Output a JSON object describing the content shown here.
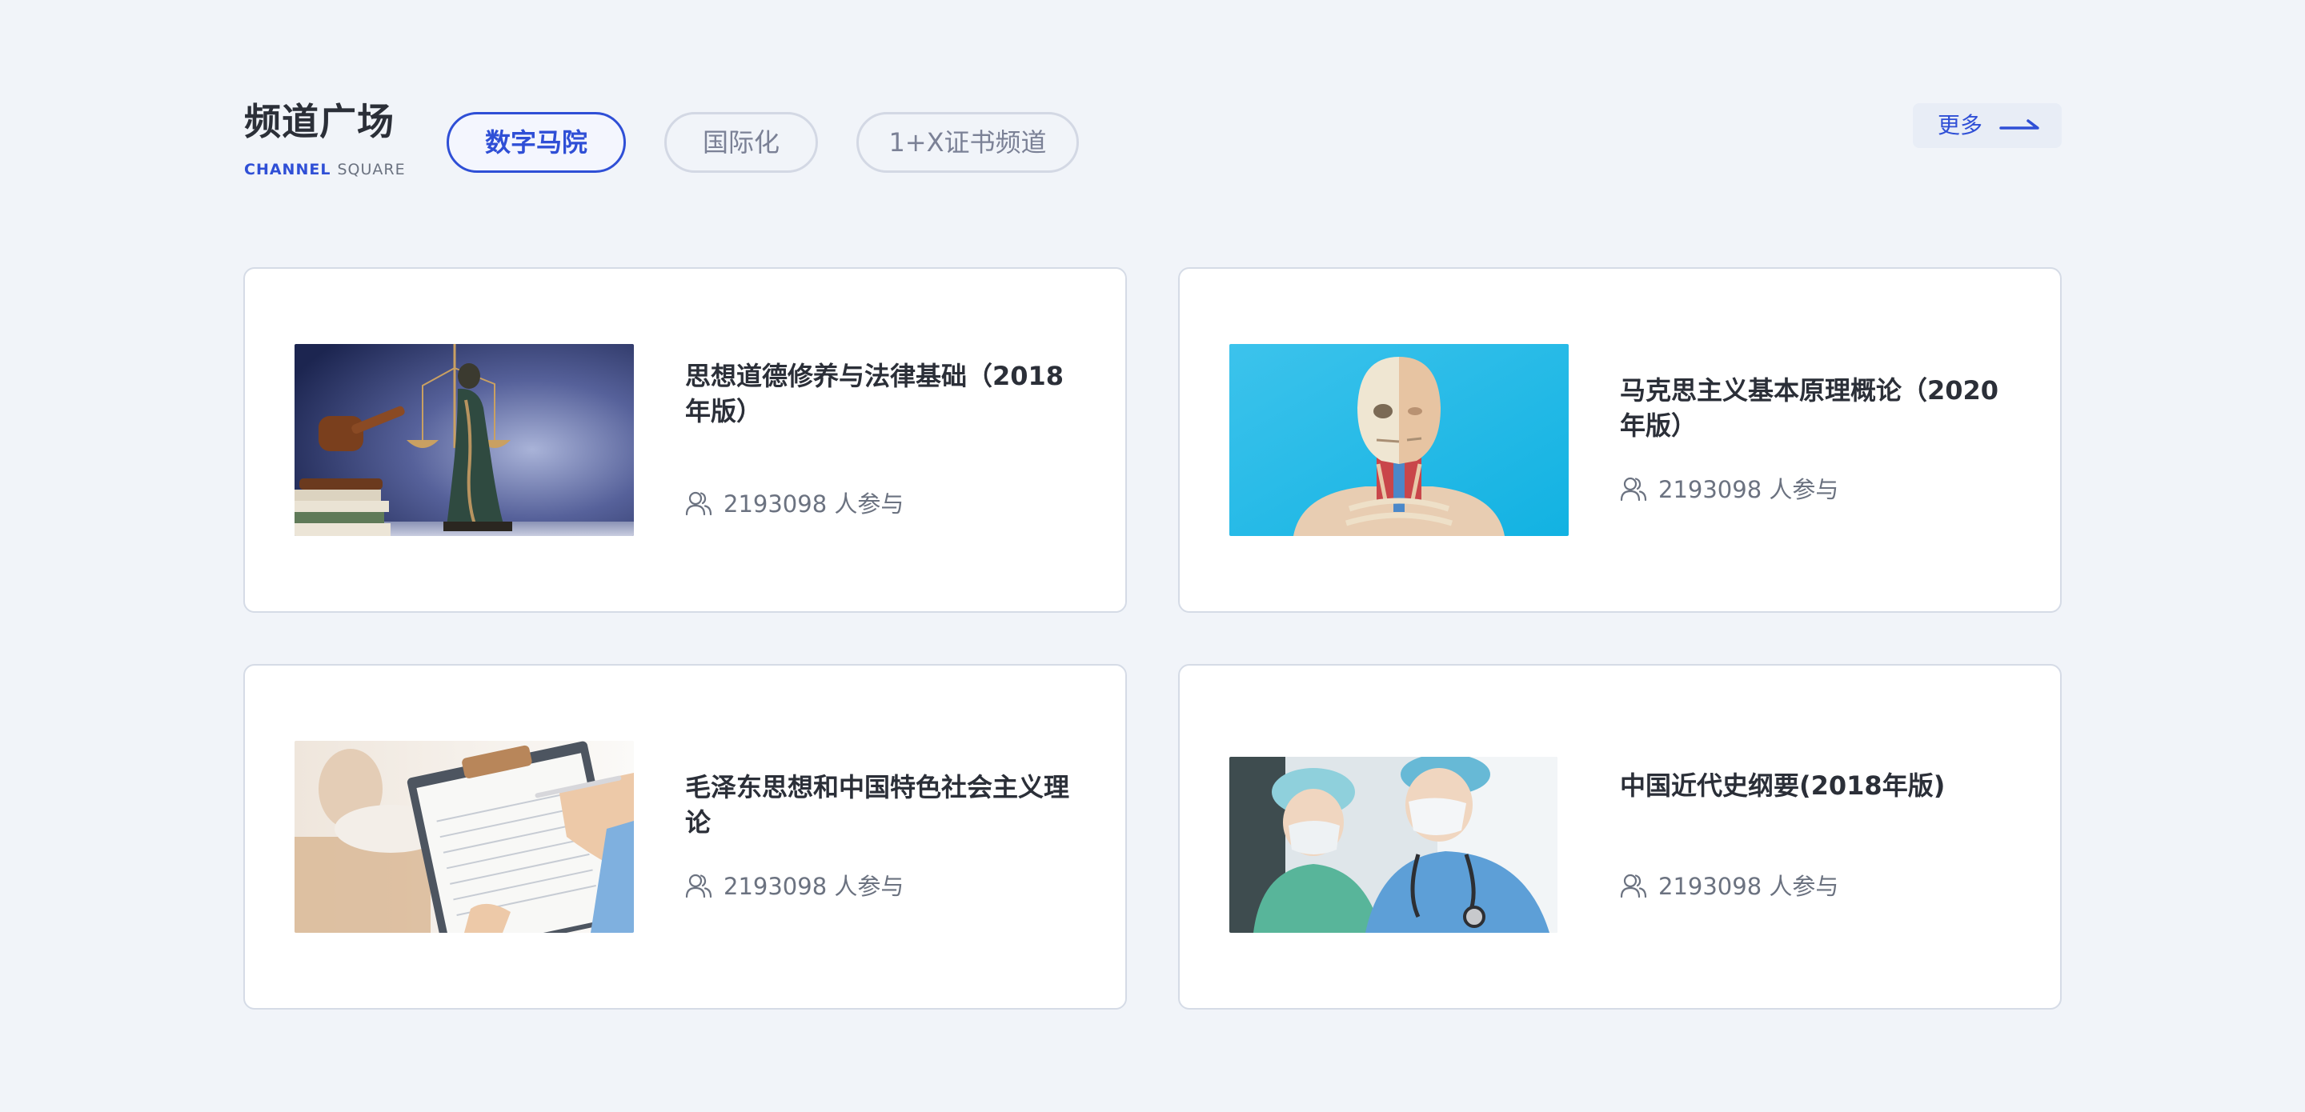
{
  "section": {
    "title": "频道广场",
    "subtitle_primary": "CHANNEL",
    "subtitle_secondary": "SQUARE"
  },
  "tabs": [
    {
      "label": "数字马院",
      "active": true
    },
    {
      "label": "国际化",
      "active": false
    },
    {
      "label": "1+X证书频道",
      "active": false
    }
  ],
  "more": {
    "label": "更多",
    "icon": "arrow-right-icon"
  },
  "courses": [
    {
      "title": "思想道德修养与法律基础（2018年版）",
      "participants": "2193098 人参与",
      "image": "justice-statue-gavel-image",
      "icon": "people-icon"
    },
    {
      "title": "马克思主义基本原理概论（2020年版）",
      "participants": "2193098 人参与",
      "image": "anatomy-model-image",
      "icon": "people-icon"
    },
    {
      "title": "毛泽东思想和中国特色社会主义理论",
      "participants": "2193098 人参与",
      "image": "clipboard-writing-image",
      "icon": "people-icon"
    },
    {
      "title": "中国近代史纲要(2018年版)",
      "participants": "2193098 人参与",
      "image": "medical-staff-image",
      "icon": "people-icon"
    }
  ],
  "colors": {
    "background": "#f1f4f9",
    "accent": "#2f4fd6",
    "text": "#2b2f38",
    "muted": "#6b7280",
    "border": "#d5dbe6"
  }
}
